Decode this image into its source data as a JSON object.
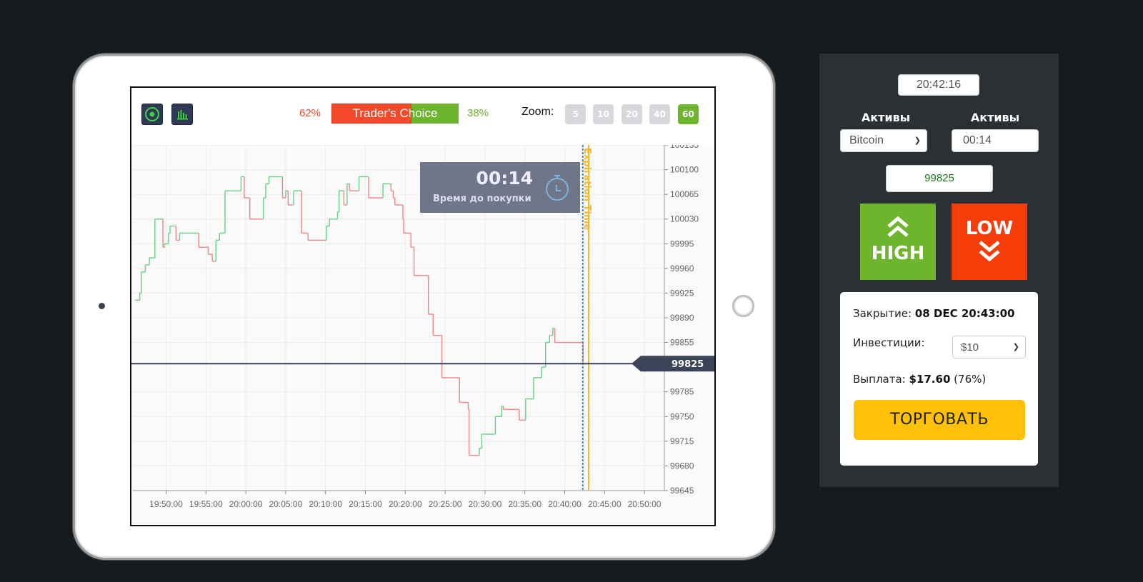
{
  "toolbar": {
    "icons": [
      "target-icon",
      "bar-chart-icon"
    ],
    "sell_pct": "62%",
    "traders_choice": "Trader's Choice",
    "sell_fraction": 0.62,
    "buy_pct": "38%",
    "zoom_label": "Zoom:",
    "zoom_options": [
      "5",
      "10",
      "20",
      "40",
      "60"
    ],
    "zoom_selected": "60"
  },
  "timer": {
    "value": "00:14",
    "label": "Время до покупки"
  },
  "colors": {
    "up": "#6dd38a",
    "down": "#f08a8a",
    "expiration": "#f5b82e",
    "current": "#3b4459",
    "high": "#6cb52d",
    "low": "#f53d0a",
    "trade": "#ffc107"
  },
  "chart_data": {
    "type": "line",
    "step": true,
    "xlabel": "",
    "ylabel": "",
    "x_ticks": [
      "19:50:00",
      "19:55:00",
      "20:00:00",
      "20:05:00",
      "20:10:00",
      "20:15:00",
      "20:20:00",
      "20:25:00",
      "20:30:00",
      "20:35:00",
      "20:40:00",
      "20:45:00",
      "20:50:00"
    ],
    "y_ticks": [
      "100135",
      "100100",
      "100065",
      "100030",
      "99995",
      "99960",
      "99925",
      "99890",
      "99855",
      "99825",
      "99785",
      "99750",
      "99715",
      "99680",
      "99645"
    ],
    "ylim": [
      99645,
      100135
    ],
    "xlim": [
      "19:45:50",
      "20:52:30"
    ],
    "grid": true,
    "current_price": "99825",
    "current_time": "20:42:16",
    "expiration_time": "20:43:00",
    "expiration_label": "Expiration Time",
    "points": [
      [
        "19:46:06",
        99915
      ],
      [
        "19:46:42",
        99925
      ],
      [
        "19:46:54",
        99955
      ],
      [
        "19:47:24",
        99965
      ],
      [
        "19:47:54",
        99975
      ],
      [
        "19:48:36",
        100030
      ],
      [
        "19:49:36",
        99990
      ],
      [
        "19:49:48",
        99995
      ],
      [
        "19:50:18",
        100010
      ],
      [
        "19:50:30",
        100020
      ],
      [
        "19:51:15",
        100000
      ],
      [
        "19:51:42",
        100010
      ],
      [
        "19:54:06",
        99990
      ],
      [
        "19:55:18",
        99980
      ],
      [
        "19:55:48",
        99970
      ],
      [
        "19:56:15",
        100000
      ],
      [
        "19:56:42",
        100010
      ],
      [
        "19:57:24",
        100070
      ],
      [
        "19:59:24",
        100090
      ],
      [
        "19:59:48",
        100060
      ],
      [
        "20:00:30",
        100030
      ],
      [
        "20:02:12",
        100060
      ],
      [
        "20:02:30",
        100080
      ],
      [
        "20:02:54",
        100090
      ],
      [
        "20:04:36",
        100060
      ],
      [
        "20:05:00",
        100070
      ],
      [
        "20:05:18",
        100050
      ],
      [
        "20:06:00",
        100070
      ],
      [
        "20:07:00",
        100010
      ],
      [
        "20:07:48",
        100000
      ],
      [
        "20:10:06",
        100020
      ],
      [
        "20:10:30",
        100030
      ],
      [
        "20:11:30",
        100040
      ],
      [
        "20:11:42",
        100070
      ],
      [
        "20:12:18",
        100050
      ],
      [
        "20:12:42",
        100080
      ],
      [
        "20:13:00",
        100070
      ],
      [
        "20:14:12",
        100090
      ],
      [
        "20:15:24",
        100060
      ],
      [
        "20:17:12",
        100080
      ],
      [
        "20:18:12",
        100070
      ],
      [
        "20:18:30",
        100060
      ],
      [
        "20:18:42",
        100050
      ],
      [
        "20:19:42",
        100030
      ],
      [
        "20:19:48",
        100010
      ],
      [
        "20:20:42",
        99990
      ],
      [
        "20:21:06",
        99950
      ],
      [
        "20:22:54",
        99895
      ],
      [
        "20:23:30",
        99865
      ],
      [
        "20:24:36",
        99805
      ],
      [
        "20:26:48",
        99770
      ],
      [
        "20:27:54",
        99760
      ],
      [
        "20:28:00",
        99695
      ],
      [
        "20:29:18",
        99705
      ],
      [
        "20:29:36",
        99725
      ],
      [
        "20:31:18",
        99750
      ],
      [
        "20:32:06",
        99765
      ],
      [
        "20:32:18",
        99760
      ],
      [
        "20:34:18",
        99745
      ],
      [
        "20:35:06",
        99775
      ],
      [
        "20:36:06",
        99805
      ],
      [
        "20:37:06",
        99820
      ],
      [
        "20:37:36",
        99855
      ],
      [
        "20:38:06",
        99865
      ],
      [
        "20:38:30",
        99875
      ],
      [
        "20:38:45",
        99855
      ],
      [
        "20:42:18",
        99825
      ]
    ]
  },
  "panel": {
    "clock": "20:42:16",
    "asset_label": "Активы",
    "asset_value": "Bitcoin",
    "duration_label": "Активы",
    "duration_value": "00:14",
    "price": "99825",
    "high_label": "HIGH",
    "low_label": "LOW",
    "closing_label": "Закрытие:",
    "closing_value": "08 DEC 20:43:00",
    "investment_label": "Инвестиции:",
    "investment_value": "$10",
    "payout_label": "Выплата:",
    "payout_value": "$17.60",
    "payout_pct": "(76%)",
    "trade_label": "ТОРГОВАТЬ"
  }
}
